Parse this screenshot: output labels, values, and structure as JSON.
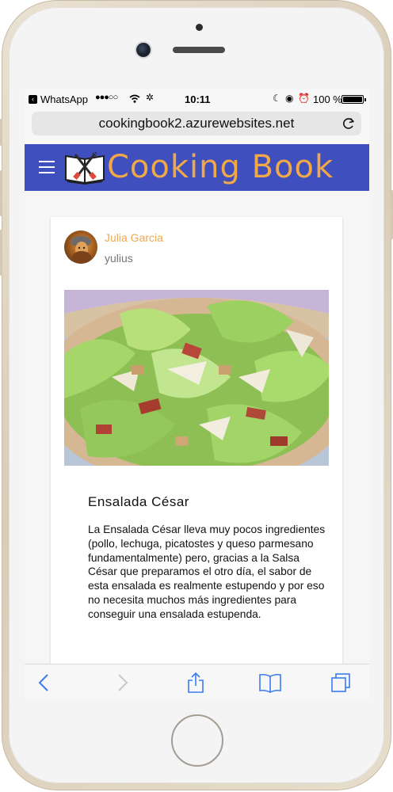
{
  "status_bar": {
    "back_app": "WhatsApp",
    "signal": "●●●○○",
    "time": "10:11",
    "battery": "100 %"
  },
  "browser": {
    "url": "cookingbook2.azurewebsites.net"
  },
  "app": {
    "title": "Cooking Book",
    "accent_color": "#3f4fbd",
    "title_color": "#f0a848"
  },
  "post": {
    "author_name": "Julia Garcia",
    "author_username": "yulius",
    "recipe_title": "Ensalada César",
    "recipe_description": "La Ensalada César lleva muy pocos ingredientes (pollo, lechuga, picatostes y queso parmesano fundamentalmente) pero, gracias a la Salsa César que preparamos el otro día, el sabor de esta ensalada es realmente estupendo y por eso no necesita muchos más ingredientes para conseguir una ensalada estupenda."
  },
  "toolbar": {
    "icons": [
      "back-icon",
      "forward-icon",
      "share-icon",
      "bookmarks-icon",
      "tabs-icon"
    ]
  }
}
